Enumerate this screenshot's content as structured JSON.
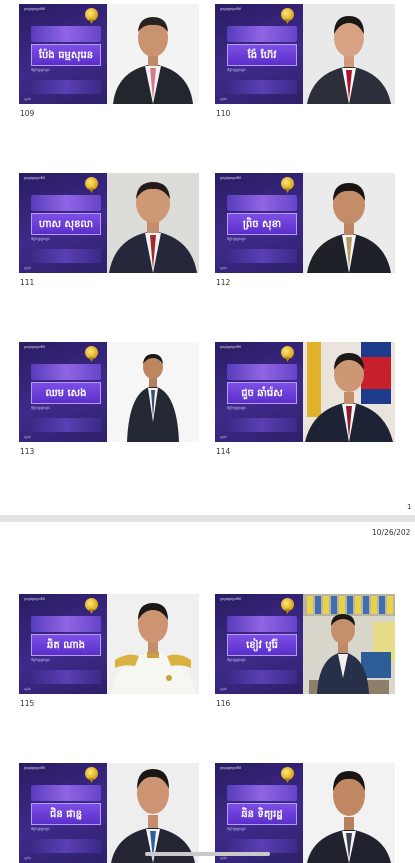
{
  "page": {
    "number": "1",
    "datestamp": "10/26/202"
  },
  "cards": [
    {
      "id": "109",
      "header": "ក្រសួងព្រហ្មចារីយ៍",
      "name": "ប៉ែង ធម្មសុរេន",
      "subtitle": "ទីប្រឹក្សាក្រសួង",
      "footer": "ស្នាដៃ"
    },
    {
      "id": "110",
      "header": "ក្រសួងព្រហ្មចារីយ៍",
      "name": "ង៉ែ ហ៊ែវ",
      "subtitle": "ទីប្រឹក្សាក្រសួង",
      "footer": "ស្នាដៃ"
    },
    {
      "id": "111",
      "header": "ក្រសួងព្រហ្មចារីយ៍",
      "name": "ហាស សុខលា",
      "subtitle": "ទីប្រឹក្សាក្រសួង",
      "footer": "ស្នាដៃ"
    },
    {
      "id": "112",
      "header": "ក្រសួងព្រហ្មចារីយ៍",
      "name": "ព្រិច សុខា",
      "subtitle": "ទីប្រឹក្សាក្រសួង",
      "footer": "ស្នាដៃ"
    },
    {
      "id": "113",
      "header": "ក្រសួងព្រហ្មចារីយ៍",
      "name": "ឈម សេង",
      "subtitle": "ទីប្រឹក្សាក្រសួង",
      "footer": "ស្នាដៃ"
    },
    {
      "id": "114",
      "header": "ក្រសួងព្រហ្មចារីយ៍",
      "name": "ជួច ឆាំរ៉េស",
      "subtitle": "ទីប្រឹក្សាក្រសួង",
      "footer": "ស្នាដៃ"
    },
    {
      "id": "115",
      "header": "ក្រសួងព្រហ្មចារីយ៍",
      "name": "ឆិត ណាង",
      "subtitle": "ទីប្រឹក្សាក្រសួង",
      "footer": "ស្នាដៃ"
    },
    {
      "id": "116",
      "header": "ក្រសួងព្រហ្មចារីយ៍",
      "name": "ខៀវ បូរ៉ែ",
      "subtitle": "ទីប្រឹក្សាក្រសួង",
      "footer": "ស្នាដៃ"
    },
    {
      "id": "117",
      "header": "ក្រសួងព្រហ្មចារីយ៍",
      "name": "ជិន ផាន្ន",
      "subtitle": "ទីប្រឹក្សាក្រសួង",
      "footer": "ស្នាដៃ"
    },
    {
      "id": "118",
      "header": "ក្រសួងព្រហ្មចារីយ៍",
      "name": "ឆិន ទិត្យរដ្ឋ",
      "subtitle": "ទីប្រឹក្សាក្រសួង",
      "footer": "ស្នាដៃ"
    }
  ],
  "colors": {
    "card_purple": "#3e2a8a",
    "name_box": "#7d4fe6",
    "badge_gold": "#d8a416"
  }
}
